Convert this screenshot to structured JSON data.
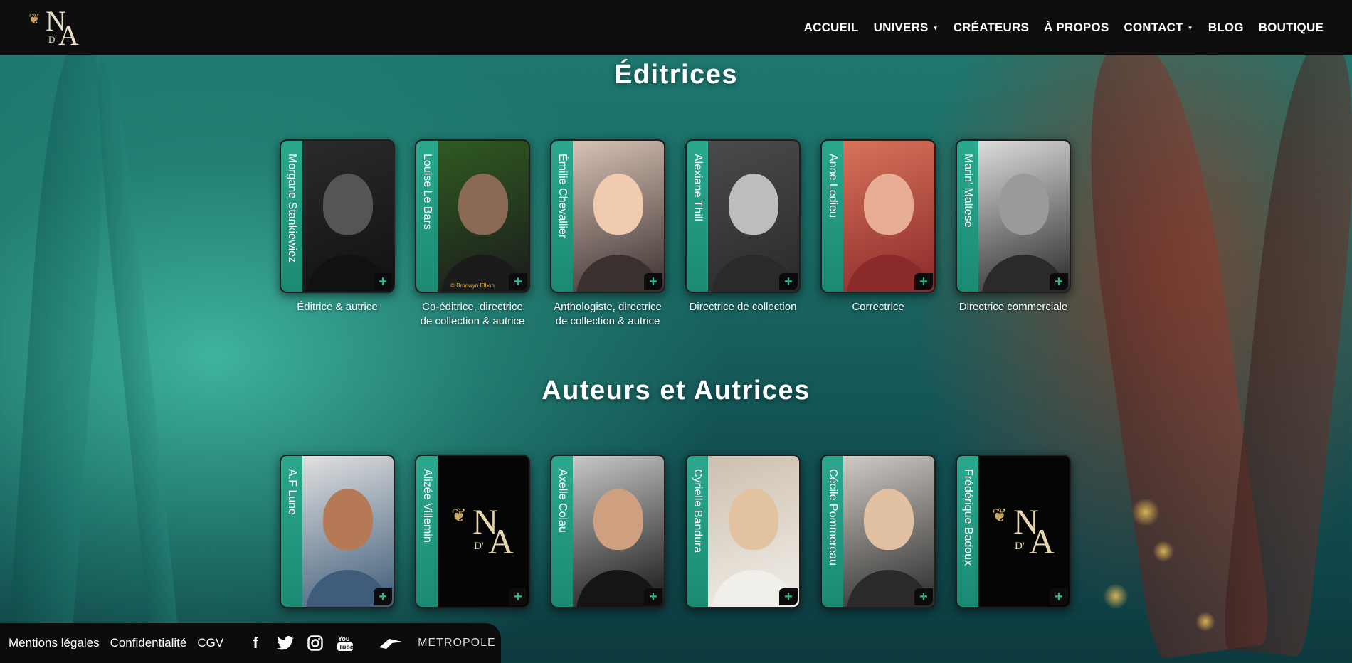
{
  "header": {
    "logo_alt": "NA",
    "nav": [
      {
        "label": "ACCUEIL",
        "dropdown": false
      },
      {
        "label": "UNIVERS",
        "dropdown": true
      },
      {
        "label": "CRÉATEURS",
        "dropdown": false
      },
      {
        "label": "À PROPOS",
        "dropdown": false
      },
      {
        "label": "CONTACT",
        "dropdown": true
      },
      {
        "label": "BLOG",
        "dropdown": false
      },
      {
        "label": "BOUTIQUE",
        "dropdown": false
      }
    ]
  },
  "editrices": {
    "title": "Éditrices",
    "people": [
      {
        "name": "Morgane Stankiewiez",
        "role": "Éditrice & autrice",
        "photo_colors": [
          "#2a2a2a",
          "#555555",
          "#111111"
        ]
      },
      {
        "name": "Louise Le Bars",
        "role": "Co-éditrice, directrice de collection & autrice",
        "photo_colors": [
          "#2f5a22",
          "#8a6a55",
          "#1b1b1b"
        ],
        "credit": "© Bronwyn Elbon"
      },
      {
        "name": "Émilie Chevallier",
        "role": "Anthologiste, directrice de collection & autrice",
        "photo_colors": [
          "#d8c2b4",
          "#f0cbb0",
          "#3a3030"
        ]
      },
      {
        "name": "Alexiane Thill",
        "role": "Directrice de collection",
        "photo_colors": [
          "#4a4a4a",
          "#bdbdbd",
          "#2a2a2a"
        ]
      },
      {
        "name": "Anne Ledieu",
        "role": "Correctrice",
        "photo_colors": [
          "#d7725a",
          "#e7ae95",
          "#8a2a2a"
        ]
      },
      {
        "name": "Marin' Maltese",
        "role": "Directrice commerciale",
        "photo_colors": [
          "#dcdcdc",
          "#9a9a9a",
          "#2a2a2a"
        ]
      }
    ]
  },
  "auteurs": {
    "title": "Auteurs et Autrices",
    "people": [
      {
        "name": "A.F Lune",
        "photo_colors": [
          "#e0e0e0",
          "#b57a55",
          "#3f5d7a"
        ]
      },
      {
        "name": "Alizée Villemin",
        "photo": "logo"
      },
      {
        "name": "Axelle Colau",
        "photo_colors": [
          "#c7c7c7",
          "#cfa080",
          "#151515"
        ]
      },
      {
        "name": "Cyrielle Bandura",
        "photo_colors": [
          "#cdbfae",
          "#e3c2a2",
          "#f1efea"
        ]
      },
      {
        "name": "Cécile Pommereau",
        "photo_colors": [
          "#cfcac4",
          "#e2c1a3",
          "#2a2a2a"
        ]
      },
      {
        "name": "Frédérique Badoux",
        "photo": "logo"
      }
    ]
  },
  "footer": {
    "links": [
      "Mentions légales",
      "Confidentialité",
      "CGV"
    ],
    "social": [
      "facebook-icon",
      "twitter-icon",
      "instagram-icon",
      "youtube-icon"
    ],
    "partners": {
      "region": "Région BRETAGNE",
      "metropole": "METROPOLE Rennes"
    }
  }
}
